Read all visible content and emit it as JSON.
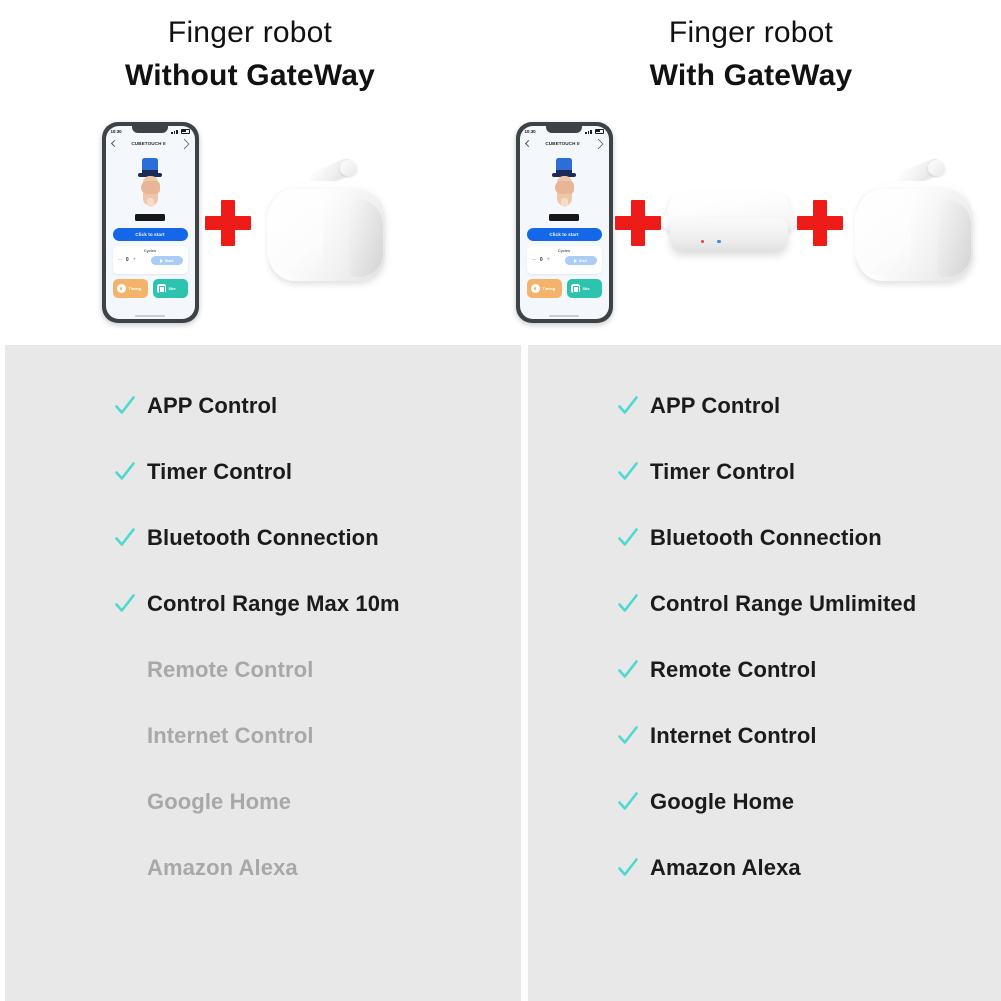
{
  "colors": {
    "panel_bg": "#e8e8e8",
    "page_bg": "#ffffff",
    "check_teal": "#4dd9d0",
    "plus_red": "#ee1c18",
    "disabled_text": "#a8a8a8",
    "enabled_text": "#1b1b1b",
    "cta_blue": "#1467e8",
    "tile_orange": "#f3b36a",
    "tile_teal": "#2cc4ae"
  },
  "columns": [
    {
      "id": "without-gateway",
      "title_line1": "Finger robot",
      "title_line2": "Without GateWay",
      "plus_symbol": "+",
      "products": [
        "phone",
        "finger-robot"
      ],
      "features": [
        {
          "label": "APP Control",
          "enabled": true
        },
        {
          "label": "Timer Control",
          "enabled": true
        },
        {
          "label": "Bluetooth Connection",
          "enabled": true
        },
        {
          "label": "Control Range Max 10m",
          "enabled": true
        },
        {
          "label": "Remote Control",
          "enabled": false
        },
        {
          "label": "Internet Control",
          "enabled": false
        },
        {
          "label": "Google Home",
          "enabled": false
        },
        {
          "label": "Amazon Alexa",
          "enabled": false
        }
      ]
    },
    {
      "id": "with-gateway",
      "title_line1": "Finger robot",
      "title_line2": "With GateWay",
      "plus_symbol": "+",
      "products": [
        "phone",
        "gateway",
        "finger-robot"
      ],
      "features": [
        {
          "label": "APP Control",
          "enabled": true
        },
        {
          "label": "Timer Control",
          "enabled": true
        },
        {
          "label": "Bluetooth Connection",
          "enabled": true
        },
        {
          "label": "Control Range Umlimited",
          "enabled": true
        },
        {
          "label": "Remote Control",
          "enabled": true
        },
        {
          "label": "Internet Control",
          "enabled": true
        },
        {
          "label": "Google Home",
          "enabled": true
        },
        {
          "label": "Amazon Alexa",
          "enabled": true
        }
      ]
    }
  ],
  "phone_app": {
    "status_time": "10:30",
    "app_title": "CUBETOUCH II",
    "cta_label": "Click to start",
    "cycles_label": "Cycles",
    "cycles_minus": "–",
    "cycles_value": "0",
    "cycles_plus": "+",
    "start_label": "Start",
    "tile_timing": "Timing",
    "tile_site": "Site"
  }
}
